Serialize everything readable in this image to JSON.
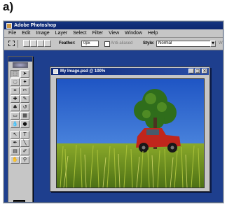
{
  "figure_label": "a)",
  "app": {
    "title": "Adobe Photoshop",
    "menu": [
      "File",
      "Edit",
      "Image",
      "Layer",
      "Select",
      "Filter",
      "View",
      "Window",
      "Help"
    ]
  },
  "options": {
    "feather_label": "Feather:",
    "feather_value": "0px",
    "antialiased_label": "Anti-aliased",
    "style_label": "Style:",
    "style_value": "Normal",
    "trailing_label": "W"
  },
  "document": {
    "title": "My Image.psd @ 100%",
    "buttons": [
      "_",
      "□",
      "×"
    ]
  },
  "tools": [
    "rectangular-marquee",
    "move",
    "lasso",
    "magic-wand",
    "crop",
    "slice",
    "healing-brush",
    "brush",
    "clone-stamp",
    "history-brush",
    "eraser",
    "gradient",
    "blur",
    "dodge",
    "path-selection",
    "type",
    "pen",
    "shape",
    "notes",
    "eyedropper",
    "hand",
    "zoom"
  ],
  "tool_glyphs": [
    "⬚",
    "➤",
    "◌",
    "✦",
    "⌗",
    "✂",
    "✚",
    "✎",
    "♣",
    "↺",
    "▭",
    "▦",
    "💧",
    "●",
    "↖",
    "T",
    "✒",
    "╲",
    "▤",
    "✐",
    "✋",
    "⚲"
  ],
  "colors": {
    "workspace": "#1e3f8e",
    "foreground": "#2a2a2a",
    "background": "#ffffff"
  }
}
